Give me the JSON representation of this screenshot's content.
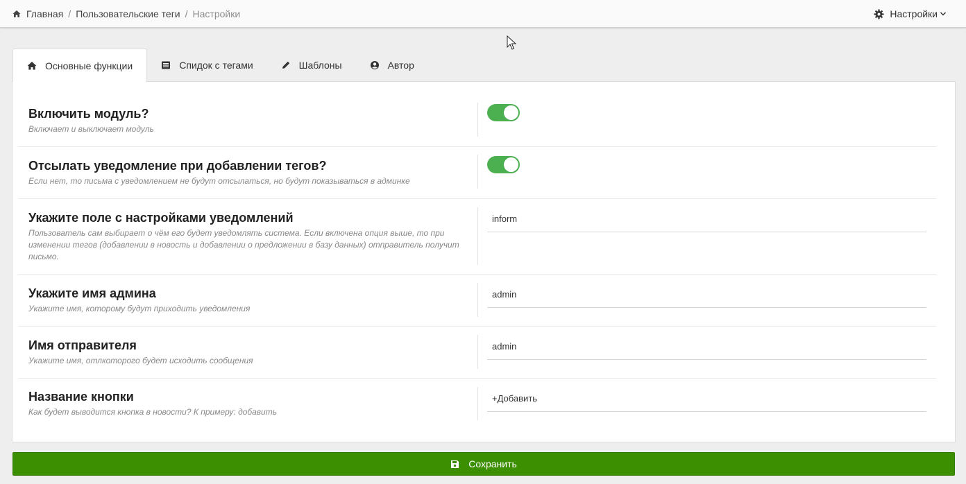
{
  "breadcrumb": {
    "home": "Главная",
    "module": "Пользовательские теги",
    "current": "Настройки"
  },
  "top_menu": {
    "settings_label": "Настройки"
  },
  "tabs": [
    {
      "label": "Основные функции",
      "icon": "home-icon",
      "active": true
    },
    {
      "label": "Спидок с тегами",
      "icon": "list-icon",
      "active": false
    },
    {
      "label": "Шаблоны",
      "icon": "pencil-icon",
      "active": false
    },
    {
      "label": "Автор",
      "icon": "user-circle-icon",
      "active": false
    }
  ],
  "settings": [
    {
      "title": "Включить модуль?",
      "desc": "Включает и выключает модуль",
      "control": "toggle",
      "enabled": true
    },
    {
      "title": "Отсылать уведомление при добавлении тегов?",
      "desc": "Если нет, то письма с уведомлением не будут отсылаться, но будут показываться в админке",
      "control": "toggle",
      "enabled": true
    },
    {
      "title": "Укажите поле с настройками уведомлений",
      "desc": "Пользователь сам выбирает о чём его будет уведомлять система. Если включена опция выше, то при изменении тегов (добавлении в новость и добавлении о предложении в базу данных) отправитель получит письмо.",
      "control": "input",
      "value": "inform"
    },
    {
      "title": "Укажите имя админа",
      "desc": "Укажите имя, которому будут приходить уведомления",
      "control": "input",
      "value": "admin"
    },
    {
      "title": "Имя отправителя",
      "desc": "Укажите имя, отлкоторого будет исходить сообщения",
      "control": "input",
      "value": "admin"
    },
    {
      "title": "Название кнопки",
      "desc": "Как будет выводится кнопка в новости? К примеру: добавить",
      "control": "input",
      "value": "+Добавить"
    }
  ],
  "save_button": {
    "label": "Сохранить",
    "icon": "floppy-icon"
  },
  "colors": {
    "accent": "#3b8f00",
    "toggle_on": "#4caf50"
  }
}
